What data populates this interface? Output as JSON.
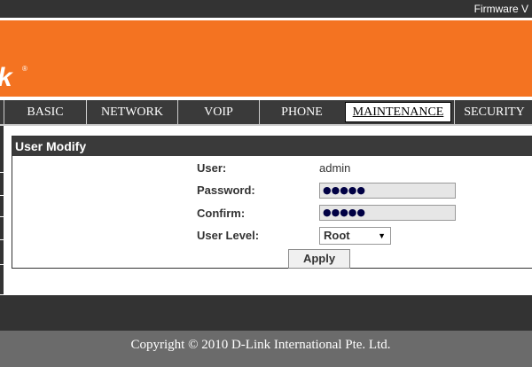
{
  "header": {
    "firmware_label": "Firmware V",
    "logo_text": "k",
    "logo_reg": "®"
  },
  "nav": {
    "tabs": [
      {
        "label": "BASIC",
        "active": false
      },
      {
        "label": "NETWORK",
        "active": false
      },
      {
        "label": "VOIP",
        "active": false
      },
      {
        "label": "PHONE",
        "active": false
      },
      {
        "label": "MAINTENANCE",
        "active": true
      },
      {
        "label": "SECURITY",
        "active": false
      }
    ]
  },
  "form": {
    "title": "User Modify",
    "user_label": "User:",
    "user_value": "admin",
    "password_label": "Password:",
    "password_value": "●●●●●",
    "confirm_label": "Confirm:",
    "confirm_value": "●●●●●",
    "level_label": "User Level:",
    "level_value": "Root",
    "apply_label": "Apply"
  },
  "footer": {
    "copyright": "Copyright © 2010 D-Link International Pte. Ltd."
  },
  "colors": {
    "brand_orange": "#f47321",
    "dark": "#333333",
    "footer_gray": "#6b6b6b"
  }
}
